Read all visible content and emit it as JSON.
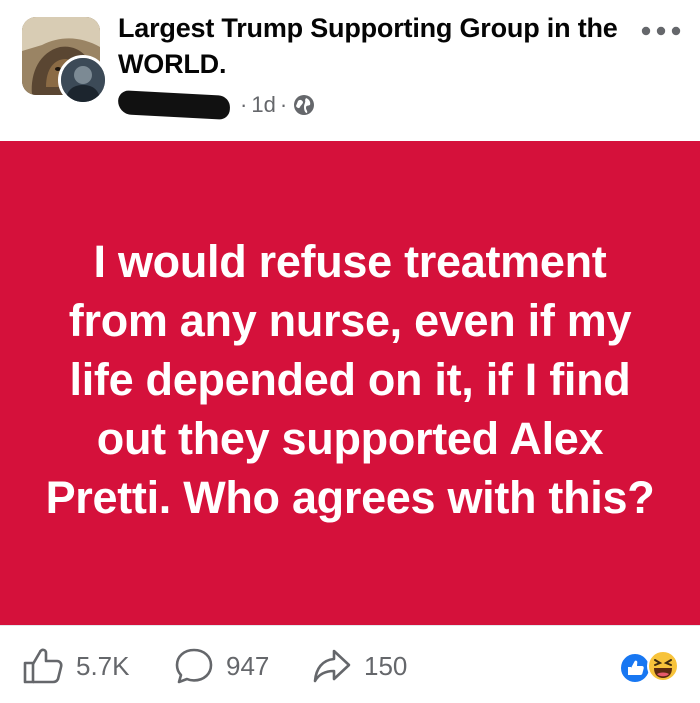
{
  "post": {
    "group_name": "Largest Trump Supporting Group in the WORLD.",
    "meta": {
      "separator": "·",
      "time": "1d",
      "audience_icon": "globe-icon"
    },
    "body_text": "I would refuse treatment from any nurse, even if my life depended on it, if I find out they supported Alex Pretti. Who agrees with this?",
    "background_color": "#d5113b"
  },
  "actions": {
    "likes": "5.7K",
    "comments": "947",
    "shares": "150"
  },
  "icons": {
    "more": "more-options-icon",
    "like": "thumbs-up-icon",
    "comment": "comment-bubble-icon",
    "share": "share-arrow-icon",
    "reactions": [
      "like-reaction-icon",
      "haha-reaction-icon"
    ]
  }
}
